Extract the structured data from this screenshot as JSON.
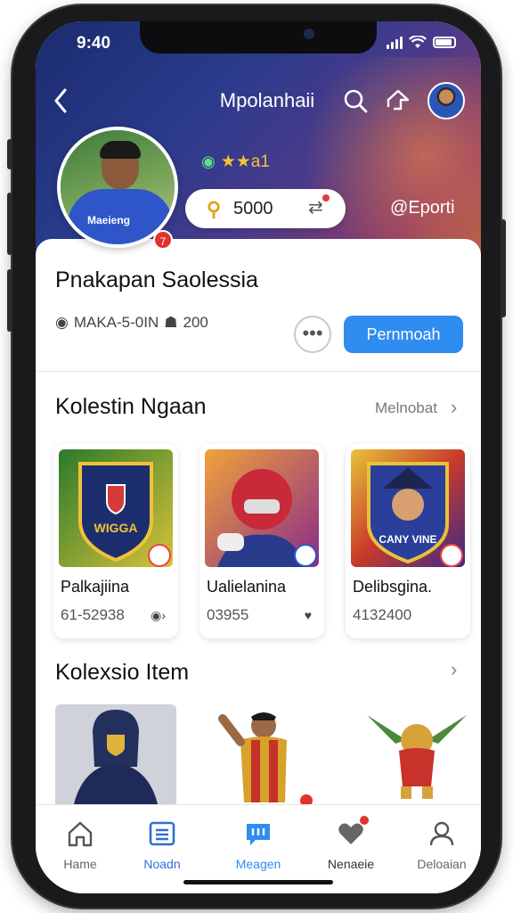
{
  "status": {
    "time": "9:40"
  },
  "header": {
    "title": "Mpolanhaii"
  },
  "profile": {
    "jersey_text": "Maeieng",
    "badge_number": "7",
    "rating_text": "★★a1",
    "coins": "5000",
    "sport_label": "Eporti",
    "name": "Pnakapan Saolessia",
    "meta_text": "MAKA-5-0IN",
    "meta_count": "200",
    "more_label": "•••",
    "primary_button": "Pernmoah"
  },
  "collections": {
    "title": "Kolestin Ngaan",
    "see_more": "Melnobat",
    "cards": [
      {
        "label": "Palkajiina",
        "value": "61-52938",
        "art_title": "WIGGA"
      },
      {
        "label": "Ualielanina",
        "value": "03955"
      },
      {
        "label": "Delibsgina.",
        "value": "4132400",
        "art_title": "CANY VINE"
      }
    ]
  },
  "items": {
    "title": "Kolexsio Item"
  },
  "nav": {
    "items": [
      {
        "label": "Hame"
      },
      {
        "label": "Noadn"
      },
      {
        "label": "Meagen"
      },
      {
        "label": "Nenaeie"
      },
      {
        "label": "Deloaian"
      }
    ]
  },
  "colors": {
    "accent": "#2f8cf0",
    "badge": "#e2322f",
    "coin": "#e0a21c"
  }
}
